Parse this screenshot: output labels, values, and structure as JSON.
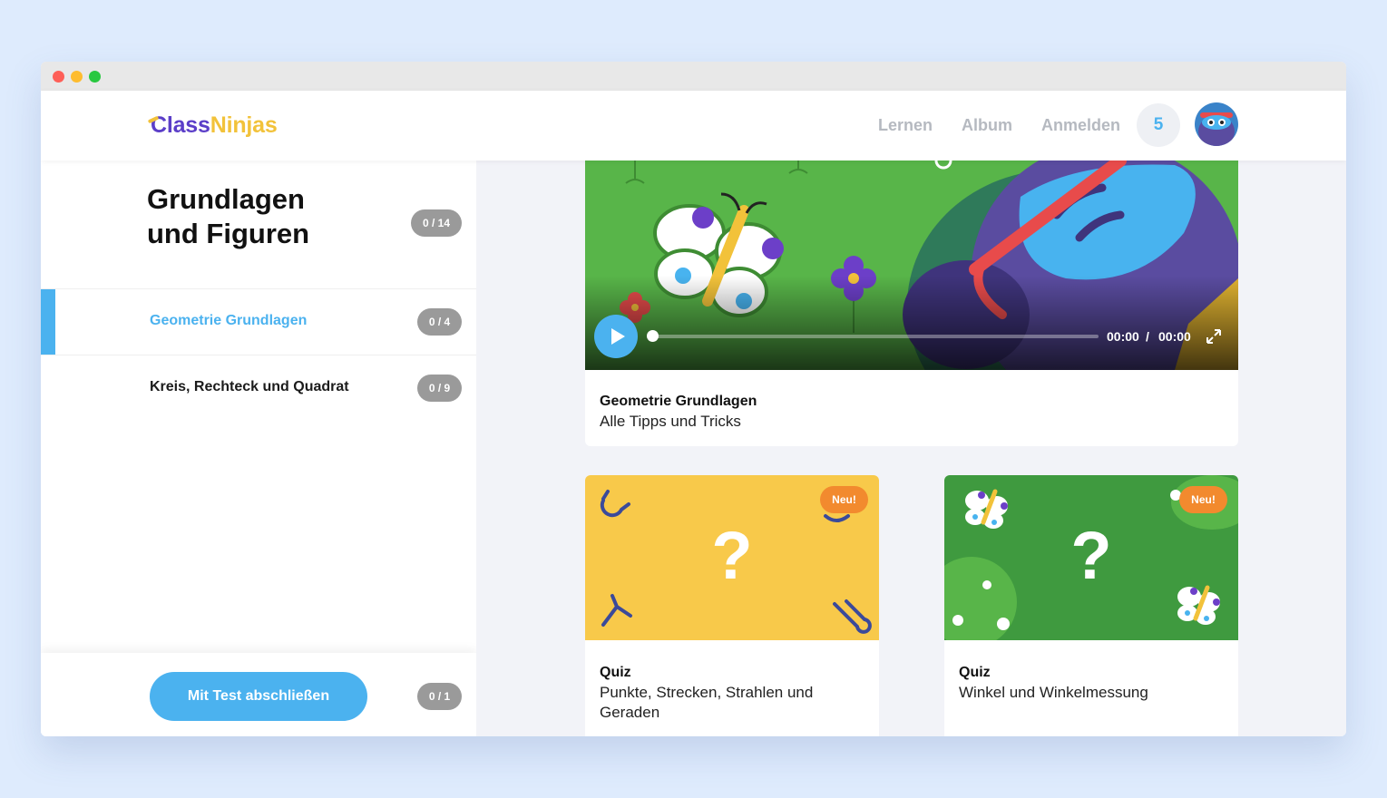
{
  "brand": {
    "name_part1": "Class",
    "name_part2": "Ninjas"
  },
  "nav": {
    "learn": "Lernen",
    "album": "Album",
    "signin": "Anmelden",
    "count": "5"
  },
  "sidebar": {
    "title_line1": "Grundlagen",
    "title_line2": "und Figuren",
    "title_progress": "0 / 14",
    "items": [
      {
        "label": "Geometrie Grundlagen",
        "progress": "0 / 4",
        "active": true
      },
      {
        "label": "Kreis, Rechteck und Quadrat",
        "progress": "0 / 9",
        "active": false
      }
    ],
    "footer": {
      "button": "Mit Test abschließen",
      "progress": "0 / 1"
    }
  },
  "video": {
    "title": "Geometrie Grundlagen",
    "subtitle": "Alle Tipps und Tricks",
    "current_time": "00:00",
    "separator": "/",
    "duration": "00:00"
  },
  "quizzes": [
    {
      "badge": "Neu!",
      "symbol": "?",
      "type": "Quiz",
      "title": "Punkte, Strecken, Strahlen und Geraden",
      "bg": "#f8c94a"
    },
    {
      "badge": "Neu!",
      "symbol": "?",
      "type": "Quiz",
      "title": "Winkel und Winkelmessung",
      "bg": "#3f9a3f"
    }
  ],
  "colors": {
    "accent": "#4bb2ef",
    "badge": "#f28a2e",
    "pill": "#9a9a9a"
  }
}
